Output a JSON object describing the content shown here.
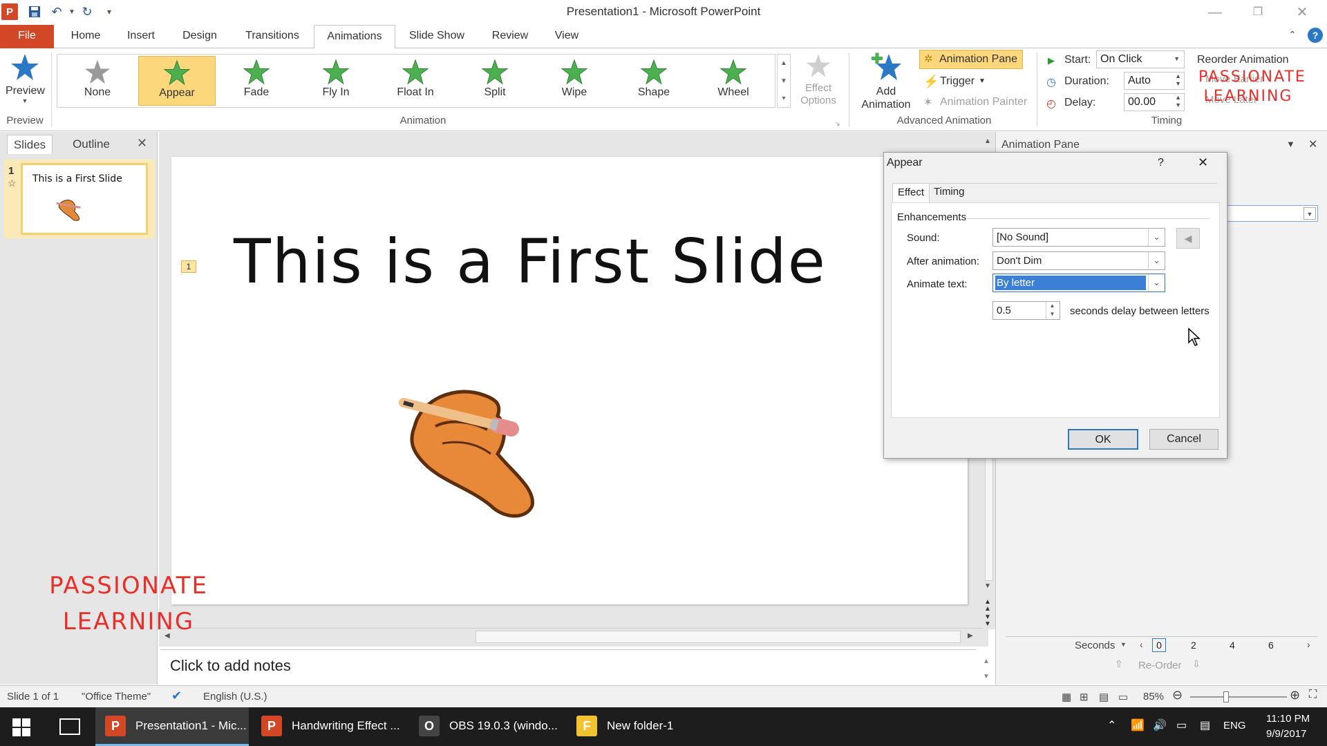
{
  "window": {
    "title": "Presentation1  -  Microsoft PowerPoint",
    "controls": [
      "minimize",
      "restore",
      "close"
    ]
  },
  "tabs": [
    {
      "label": "File"
    },
    {
      "label": "Home"
    },
    {
      "label": "Insert"
    },
    {
      "label": "Design"
    },
    {
      "label": "Transitions"
    },
    {
      "label": "Animations",
      "active": true
    },
    {
      "label": "Slide Show"
    },
    {
      "label": "Review"
    },
    {
      "label": "View"
    }
  ],
  "ribbon": {
    "preview": {
      "label": "Preview",
      "group": "Preview"
    },
    "animation_group": "Animation",
    "animations": [
      {
        "label": "None",
        "color": "#9a9a9a"
      },
      {
        "label": "Appear",
        "color": "#4caf50",
        "selected": true
      },
      {
        "label": "Fade",
        "color": "#4caf50"
      },
      {
        "label": "Fly In",
        "color": "#4caf50"
      },
      {
        "label": "Float In",
        "color": "#4caf50"
      },
      {
        "label": "Split",
        "color": "#4caf50"
      },
      {
        "label": "Wipe",
        "color": "#4caf50"
      },
      {
        "label": "Shape",
        "color": "#4caf50"
      },
      {
        "label": "Wheel",
        "color": "#4caf50"
      }
    ],
    "effect_options": {
      "line1": "Effect",
      "line2": "Options"
    },
    "add_animation": {
      "line1": "Add",
      "line2": "Animation"
    },
    "advanced_group": "Advanced Animation",
    "animation_pane_btn": "Animation Pane",
    "trigger": "Trigger",
    "animation_painter": "Animation Painter",
    "timing_group": "Timing",
    "start_label": "Start:",
    "start_value": "On Click",
    "duration_label": "Duration:",
    "duration_value": "Auto",
    "delay_label": "Delay:",
    "delay_value": "00.00",
    "reorder_label": "Reorder Animation",
    "move_earlier": "Move Earlier",
    "move_later": "Move Later"
  },
  "left_panel": {
    "tabs": [
      "Slides",
      "Outline"
    ],
    "slide_number": "1",
    "thumb_title": "This is a First Slide"
  },
  "slide": {
    "title": "This is a First Slide",
    "anim_marker": "1"
  },
  "notes": {
    "placeholder": "Click to add notes"
  },
  "animation_pane": {
    "title": "Animation Pane",
    "seconds_label": "Seconds",
    "timeline_ticks": [
      "0",
      "2",
      "4",
      "6"
    ],
    "reorder": "Re-Order"
  },
  "dialog": {
    "title": "Appear",
    "help": "?",
    "tabs": [
      "Effect",
      "Timing"
    ],
    "section": "Enhancements",
    "sound_label": "Sound:",
    "sound_value": "[No Sound]",
    "after_label": "After animation:",
    "after_value": "Don't Dim",
    "animate_text_label": "Animate text:",
    "animate_text_value": "By letter",
    "delay_value": "0.5",
    "delay_suffix": "seconds delay between letters",
    "ok": "OK",
    "cancel": "Cancel"
  },
  "status_bar": {
    "slide_info": "Slide 1 of 1",
    "theme": "\"Office Theme\"",
    "language": "English (U.S.)",
    "zoom": "85%"
  },
  "taskbar": {
    "items": [
      {
        "label": "Presentation1 - Mic...",
        "icon": "P",
        "color": "#d24726",
        "active": true
      },
      {
        "label": "Handwriting Effect ...",
        "icon": "P",
        "color": "#d24726"
      },
      {
        "label": "OBS 19.0.3 (windo...",
        "icon": "O",
        "color": "#444444"
      },
      {
        "label": "New folder-1",
        "icon": "F",
        "color": "#f1c232"
      }
    ],
    "ime": "ENG",
    "time": "11:10 PM",
    "date": "9/9/2017"
  },
  "watermark": {
    "line1": "PASSIONATE",
    "line2": "LEARNING"
  }
}
